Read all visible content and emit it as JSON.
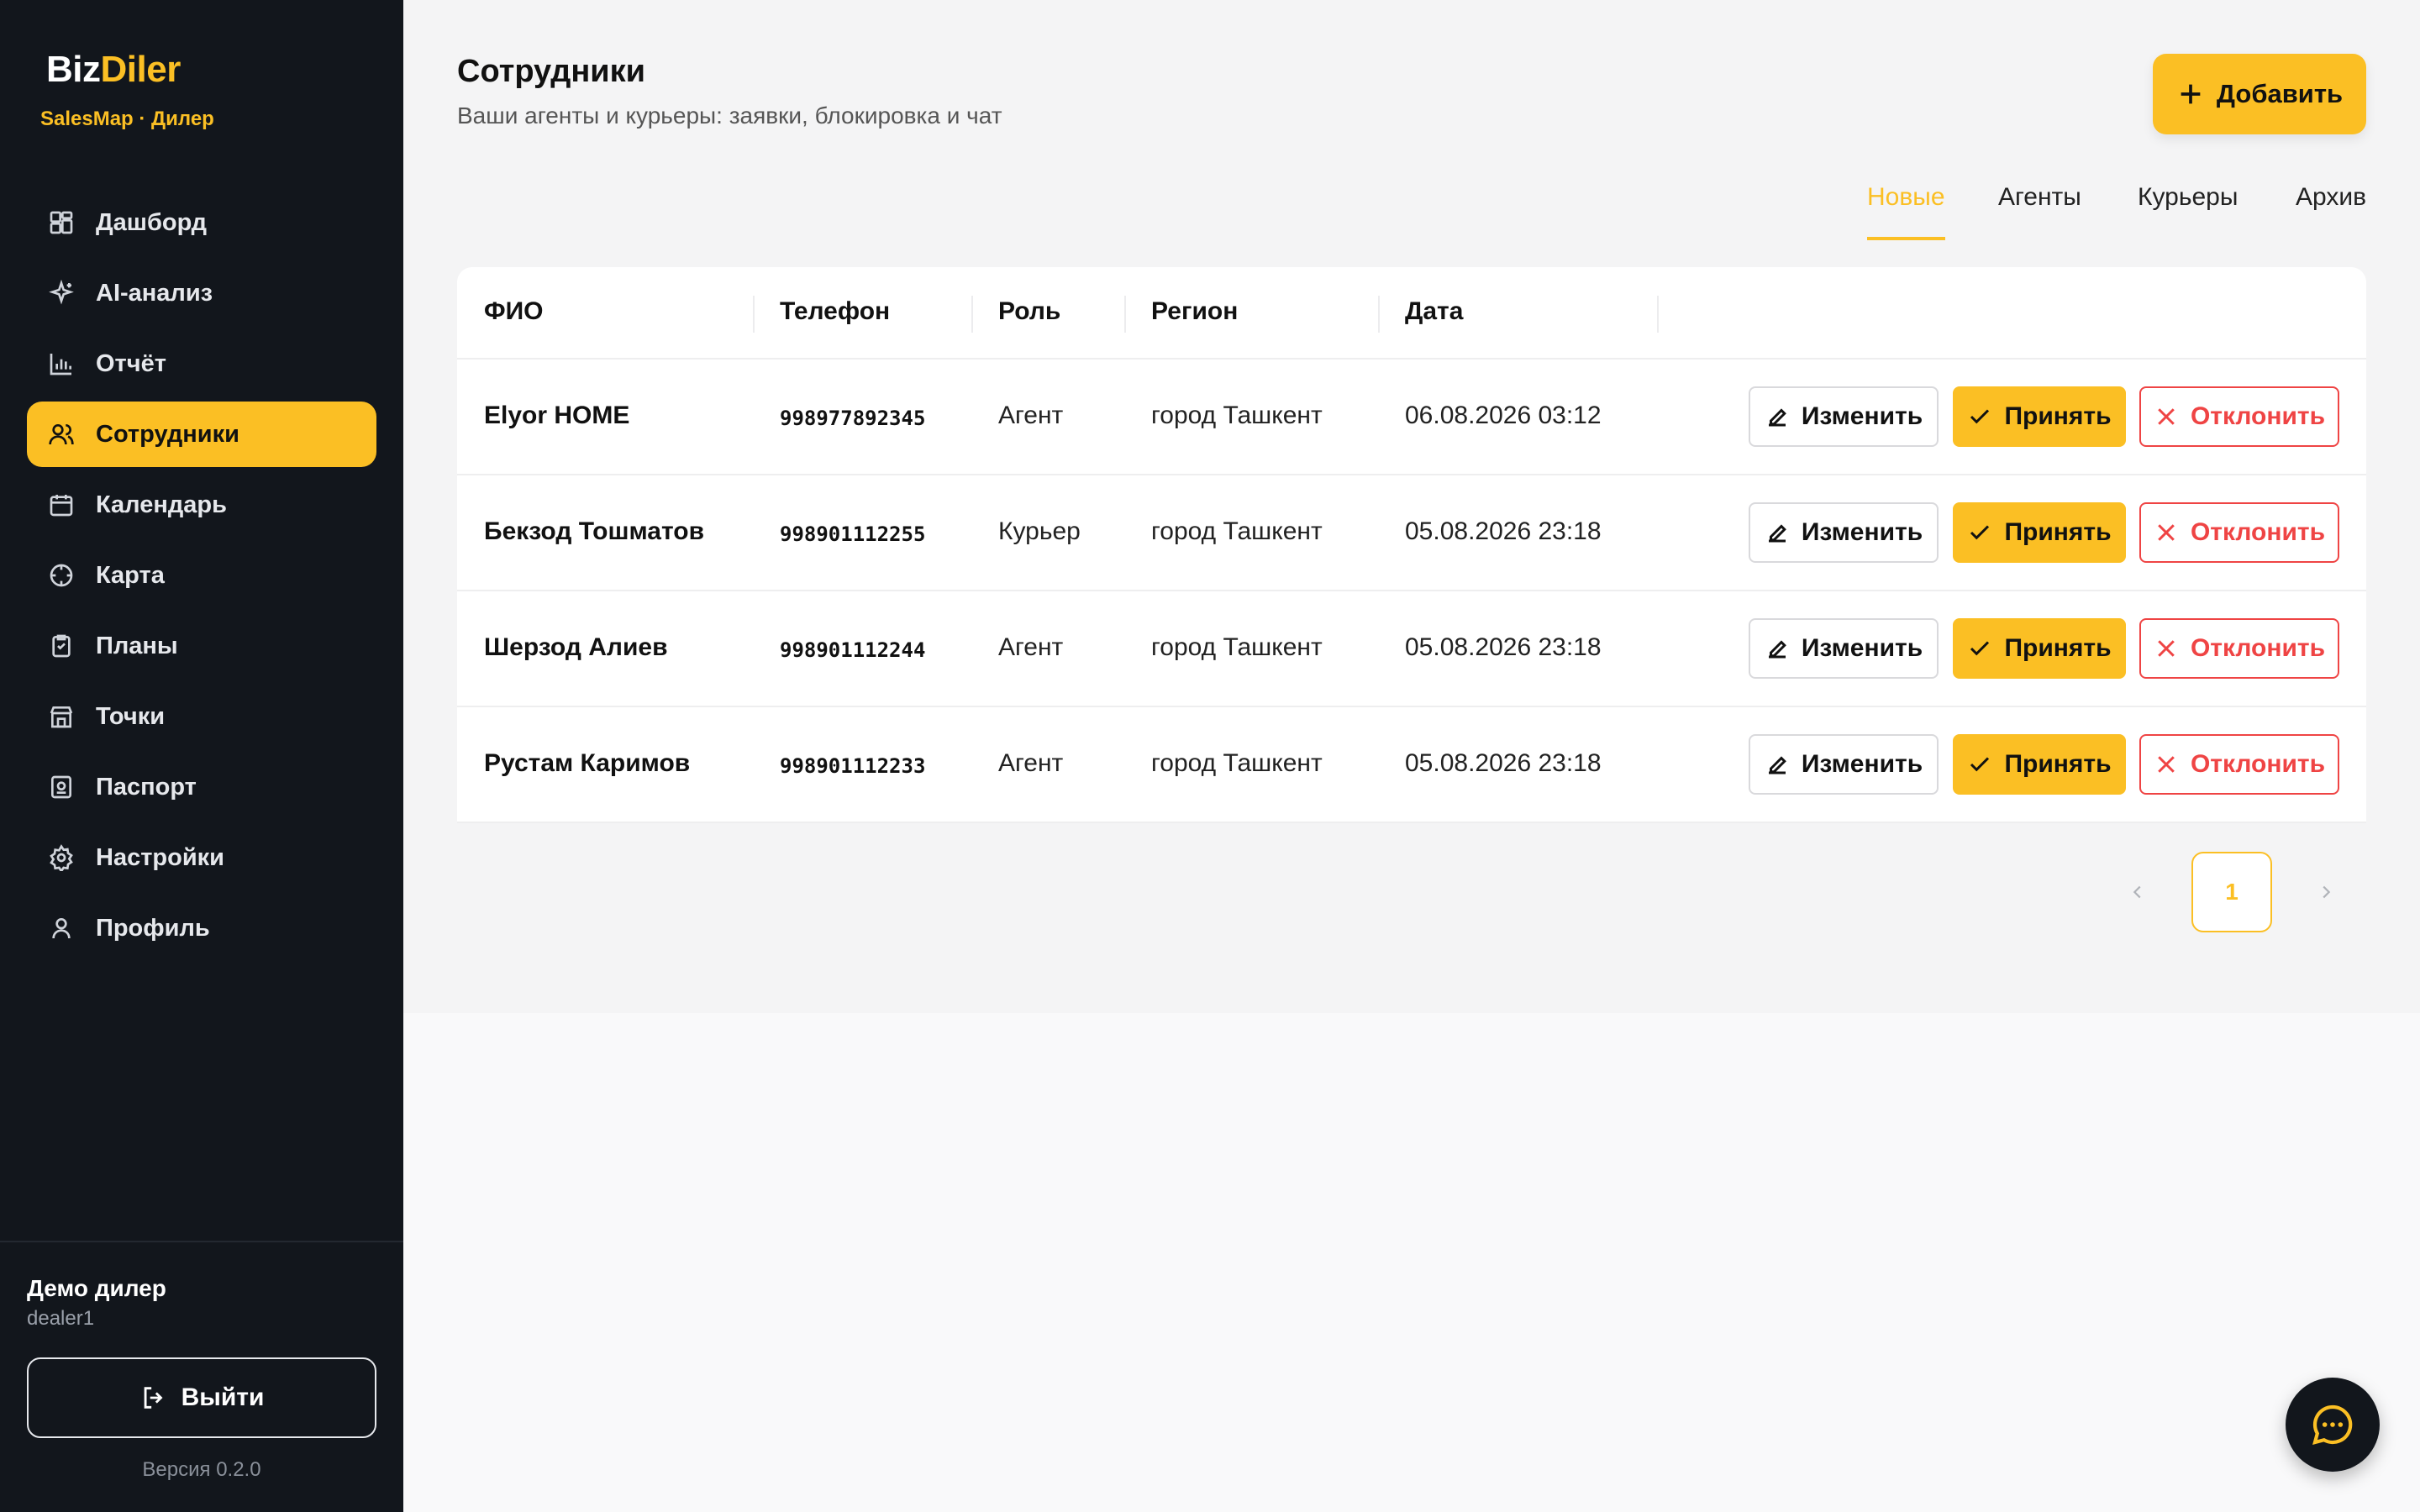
{
  "brand": {
    "name_part1": "Biz",
    "name_part2": "Diler",
    "subtitle": "SalesMap · Дилер"
  },
  "sidebar": {
    "items": [
      {
        "label": "Дашборд",
        "icon": "dashboard-icon",
        "active": false
      },
      {
        "label": "AI-анализ",
        "icon": "sparkle-icon",
        "active": false
      },
      {
        "label": "Отчёт",
        "icon": "bar-chart-icon",
        "active": false
      },
      {
        "label": "Сотрудники",
        "icon": "users-icon",
        "active": true
      },
      {
        "label": "Календарь",
        "icon": "calendar-icon",
        "active": false
      },
      {
        "label": "Карта",
        "icon": "map-target-icon",
        "active": false
      },
      {
        "label": "Планы",
        "icon": "clipboard-icon",
        "active": false
      },
      {
        "label": "Точки",
        "icon": "store-icon",
        "active": false
      },
      {
        "label": "Паспорт",
        "icon": "passport-icon",
        "active": false
      },
      {
        "label": "Настройки",
        "icon": "gear-icon",
        "active": false
      },
      {
        "label": "Профиль",
        "icon": "user-icon",
        "active": false
      }
    ],
    "user_name": "Демо дилер",
    "user_login": "dealer1",
    "logout_label": "Выйти",
    "version": "Версия 0.2.0"
  },
  "header": {
    "title": "Сотрудники",
    "subtitle": "Ваши агенты и курьеры: заявки, блокировка и чат",
    "add_label": "Добавить"
  },
  "tabs": [
    {
      "label": "Новые",
      "active": true
    },
    {
      "label": "Агенты",
      "active": false
    },
    {
      "label": "Курьеры",
      "active": false
    },
    {
      "label": "Архив",
      "active": false
    }
  ],
  "table": {
    "columns": [
      "ФИО",
      "Телефон",
      "Роль",
      "Регион",
      "Дата"
    ],
    "rows": [
      {
        "name": "Elyor HOME",
        "phone": "998977892345",
        "role": "Агент",
        "region": "город Ташкент",
        "date": "06.08.2026 03:12"
      },
      {
        "name": "Бекзод Тошматов",
        "phone": "998901112255",
        "role": "Курьер",
        "region": "город Ташкент",
        "date": "05.08.2026 23:18"
      },
      {
        "name": "Шерзод Алиев",
        "phone": "998901112244",
        "role": "Агент",
        "region": "город Ташкент",
        "date": "05.08.2026 23:18"
      },
      {
        "name": "Рустам Каримов",
        "phone": "998901112233",
        "role": "Агент",
        "region": "город Ташкент",
        "date": "05.08.2026 23:18"
      }
    ],
    "actions": {
      "edit": "Изменить",
      "accept": "Принять",
      "reject": "Отклонить"
    }
  },
  "pagination": {
    "current_page": "1"
  },
  "colors": {
    "accent": "#fbbf24",
    "sidebar_bg": "#12161c",
    "danger": "#ef4444"
  }
}
